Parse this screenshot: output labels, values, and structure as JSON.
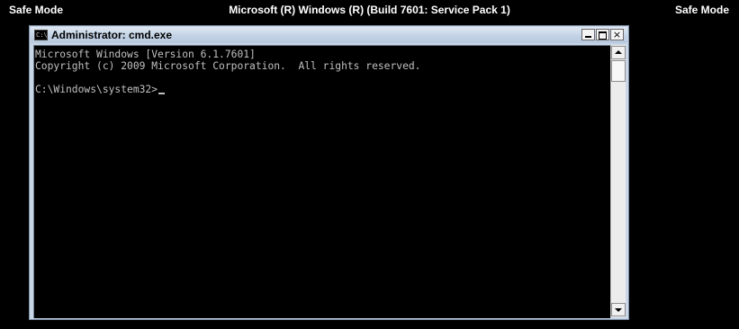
{
  "desktop": {
    "banner_left": "Safe Mode",
    "banner_center": "Microsoft (R) Windows (R) (Build 7601: Service Pack 1)",
    "banner_right": "Safe Mode"
  },
  "window": {
    "title": "Administrator: cmd.exe",
    "icon_label": "C:\\",
    "controls": {
      "minimize": "",
      "maximize": "",
      "close": "×"
    }
  },
  "console": {
    "line1": "Microsoft Windows [Version 6.1.7601]",
    "line2": "Copyright (c) 2009 Microsoft Corporation.  All rights reserved.",
    "line3": "",
    "prompt": "C:\\Windows\\system32>"
  },
  "colors": {
    "console_bg": "#000000",
    "console_fg": "#c0c0c0",
    "titlebar": "#c5d4e6",
    "desktop": "#000000"
  }
}
